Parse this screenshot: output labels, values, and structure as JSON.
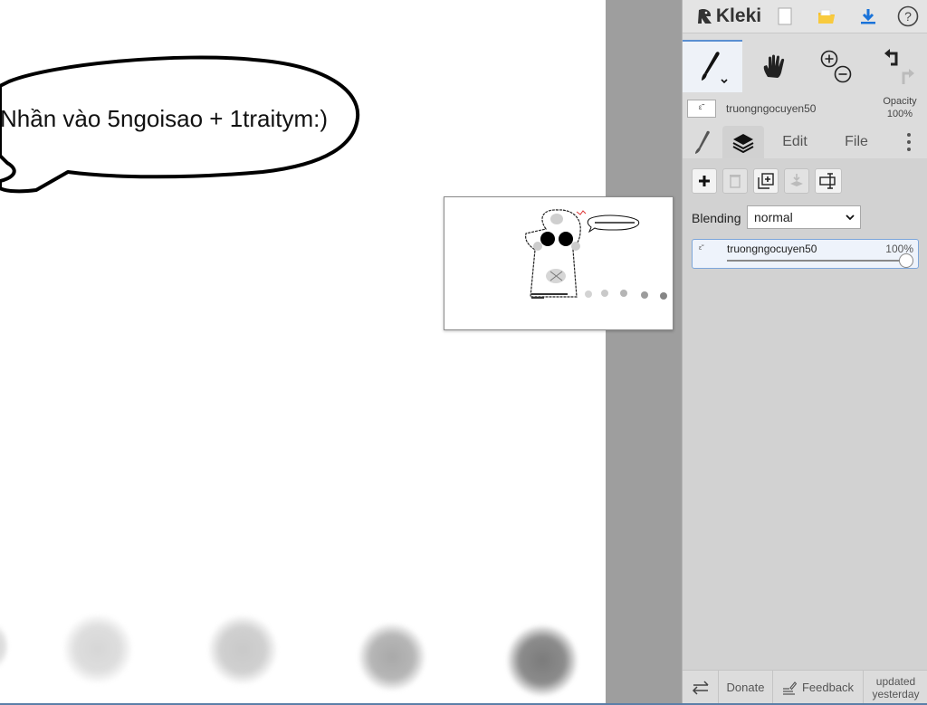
{
  "canvas": {
    "speech_bubble_text": "Nhần vào 5ngoisao + 1traitym:)",
    "navigator_label": "Navigator preview"
  },
  "sidebar": {
    "app_name": "Kleki",
    "brand_color": "#333333",
    "accent_color": "#5a8fd1",
    "topbar_icons": [
      "kleki-logo-icon",
      "new-image-icon",
      "open-folder-icon",
      "download-icon",
      "help-icon"
    ],
    "tools": [
      "brush-tool",
      "hand-tool",
      "zoom-tool",
      "undo-redo"
    ],
    "current_layer_name": "truongngocuyen50",
    "current_layer_thumb": "ε̃˜",
    "opacity_label_line1": "Opacity",
    "opacity_label_line2": "100%",
    "tabs": {
      "brush": "",
      "layers": "",
      "edit": "Edit",
      "file": "File"
    },
    "layers_panel": {
      "blending_label": "Blending",
      "blending_value": "normal",
      "layers": [
        {
          "name": "truongngocuyen50",
          "opacity": "100%",
          "thumb": "ε̃˜"
        }
      ]
    },
    "footer": {
      "donate": "Donate",
      "feedback": "Feedback",
      "updated_line1": "updated",
      "updated_line2": "yesterday"
    }
  }
}
